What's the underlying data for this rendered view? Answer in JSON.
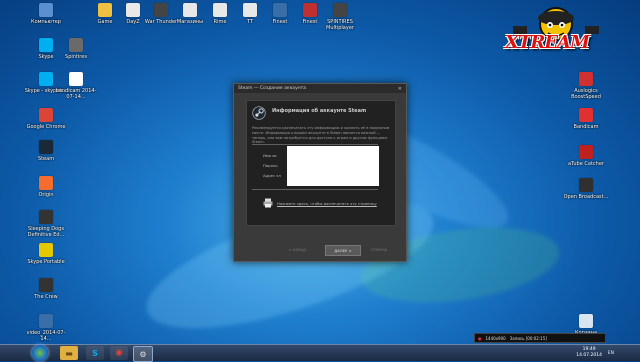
{
  "desktop": {
    "icons_left": [
      {
        "label": "Компьютер",
        "color": "#5a8fd0",
        "glyph": "computer-icon"
      },
      {
        "label": "Skype",
        "color": "#00aff0",
        "glyph": "skype-icon"
      },
      {
        "label": "Skype - skypeh...",
        "color": "#00aff0",
        "glyph": "skype-icon"
      },
      {
        "label": "Google Chrome",
        "color": "#db4437",
        "glyph": "chrome-icon"
      },
      {
        "label": "Steam",
        "color": "#1b2838",
        "glyph": "steam-icon"
      },
      {
        "label": "Origin",
        "color": "#f56c2d",
        "glyph": "origin-icon"
      },
      {
        "label": "Sleeping Dogs Definitive Ed...",
        "color": "#333333",
        "glyph": "game-icon"
      },
      {
        "label": "Skype Portable",
        "color": "#e6c800",
        "glyph": "folder-icon"
      },
      {
        "label": "The Crew",
        "color": "#333333",
        "glyph": "game-icon"
      },
      {
        "label": "video_2014-07-14...",
        "color": "#3a6ea8",
        "glyph": "video-file-icon"
      }
    ],
    "icons_left2": [
      {
        "label": "Spintires",
        "color": "#6a6a6a",
        "glyph": "game-icon"
      },
      {
        "label": "bandicam 2014-07-14...",
        "color": "#ffffff",
        "glyph": "document-icon"
      }
    ],
    "icons_top": [
      {
        "label": "Game",
        "color": "#f0c040",
        "glyph": "folder-icon"
      },
      {
        "label": "DayZ",
        "color": "#e8e8e8",
        "glyph": "document-icon"
      },
      {
        "label": "War Thunder",
        "color": "#444444",
        "glyph": "game-icon"
      },
      {
        "label": "Магазины",
        "color": "#e8e8e8",
        "glyph": "document-icon"
      },
      {
        "label": "Rime",
        "color": "#e8e8e8",
        "glyph": "document-icon"
      },
      {
        "label": "TT",
        "color": "#e8e8e8",
        "glyph": "document-icon"
      },
      {
        "label": "Finest",
        "color": "#3a6ea8",
        "glyph": "app-icon"
      },
      {
        "label": "Finest",
        "color": "#c03030",
        "glyph": "app-icon"
      },
      {
        "label": "SPINTIRES Multiplayer",
        "color": "#444444",
        "glyph": "game-icon"
      }
    ],
    "icons_right": [
      {
        "label": "Auslogics BoostSpeed",
        "color": "#d03030",
        "glyph": "boost-icon"
      },
      {
        "label": "Bandicam",
        "color": "#e03030",
        "glyph": "record-icon"
      },
      {
        "label": "aTube Catcher",
        "color": "#c02020",
        "glyph": "download-icon"
      },
      {
        "label": "Open Broadcast...",
        "color": "#303030",
        "glyph": "broadcast-icon"
      },
      {
        "label": "Корзина",
        "color": "#d8e4f0",
        "glyph": "recycle-bin-icon"
      }
    ],
    "logo": {
      "text": "XTREAM",
      "color": "#e01010"
    }
  },
  "dialog": {
    "title": "Steam — Создание аккаунта",
    "heading": "Информация об аккаунте Steam",
    "description": "Рекомендуется распечатать эту информацию и хранить её в надежном месте. Информация о вашем аккаунте в Steam является важной — теперь, она вам потребуется для доступа к играм и другим функциям Steam.",
    "fields": {
      "account_name": "Имя ак",
      "password": "Пароль",
      "email": "Адрес эл"
    },
    "print_link": "Нажмите здесь, чтобы распечатать эту страницу",
    "buttons": {
      "back": "< НАЗАД",
      "next": "ДАЛЕЕ >",
      "cancel": "ОТМЕНА"
    }
  },
  "recorder": {
    "resolution": "1440x900",
    "status": "Запись [00:02:15]"
  },
  "taskbar": {
    "lang": "EN",
    "time": "19:49",
    "date": "14.07.2014"
  }
}
